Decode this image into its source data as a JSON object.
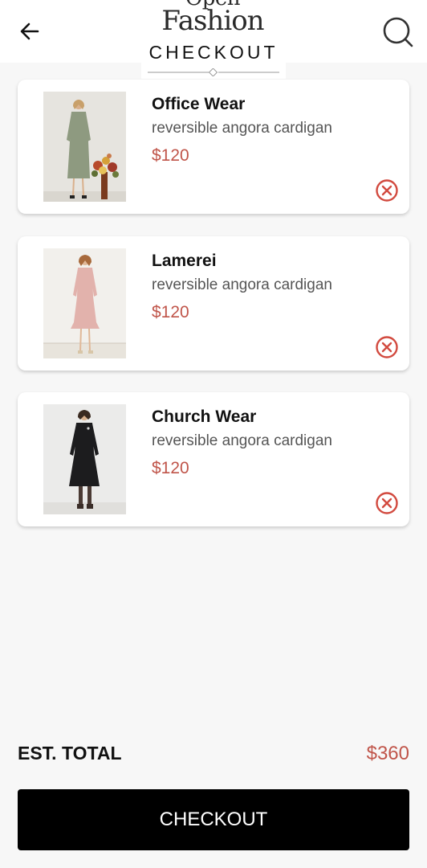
{
  "header": {
    "logo_line1": "Open",
    "logo_line2": "Fashion",
    "title": "CHECKOUT",
    "back_icon": "arrow-left-icon",
    "search_icon": "search-icon"
  },
  "cart": {
    "items": [
      {
        "title": "Office Wear",
        "description": "reversible angora cardigan",
        "price": "$120",
        "remove_icon": "remove-circle-icon"
      },
      {
        "title": "Lamerei",
        "description": "reversible angora cardigan",
        "price": "$120",
        "remove_icon": "remove-circle-icon"
      },
      {
        "title": "Church Wear",
        "description": "reversible angora cardigan",
        "price": "$120",
        "remove_icon": "remove-circle-icon"
      }
    ]
  },
  "summary": {
    "total_label": "EST. TOTAL",
    "total_value": "$360"
  },
  "checkout_button": {
    "label": "CHECKOUT"
  },
  "colors": {
    "accent": "#c0554a",
    "button_bg": "#000000",
    "page_bg": "#f7f7f7"
  }
}
